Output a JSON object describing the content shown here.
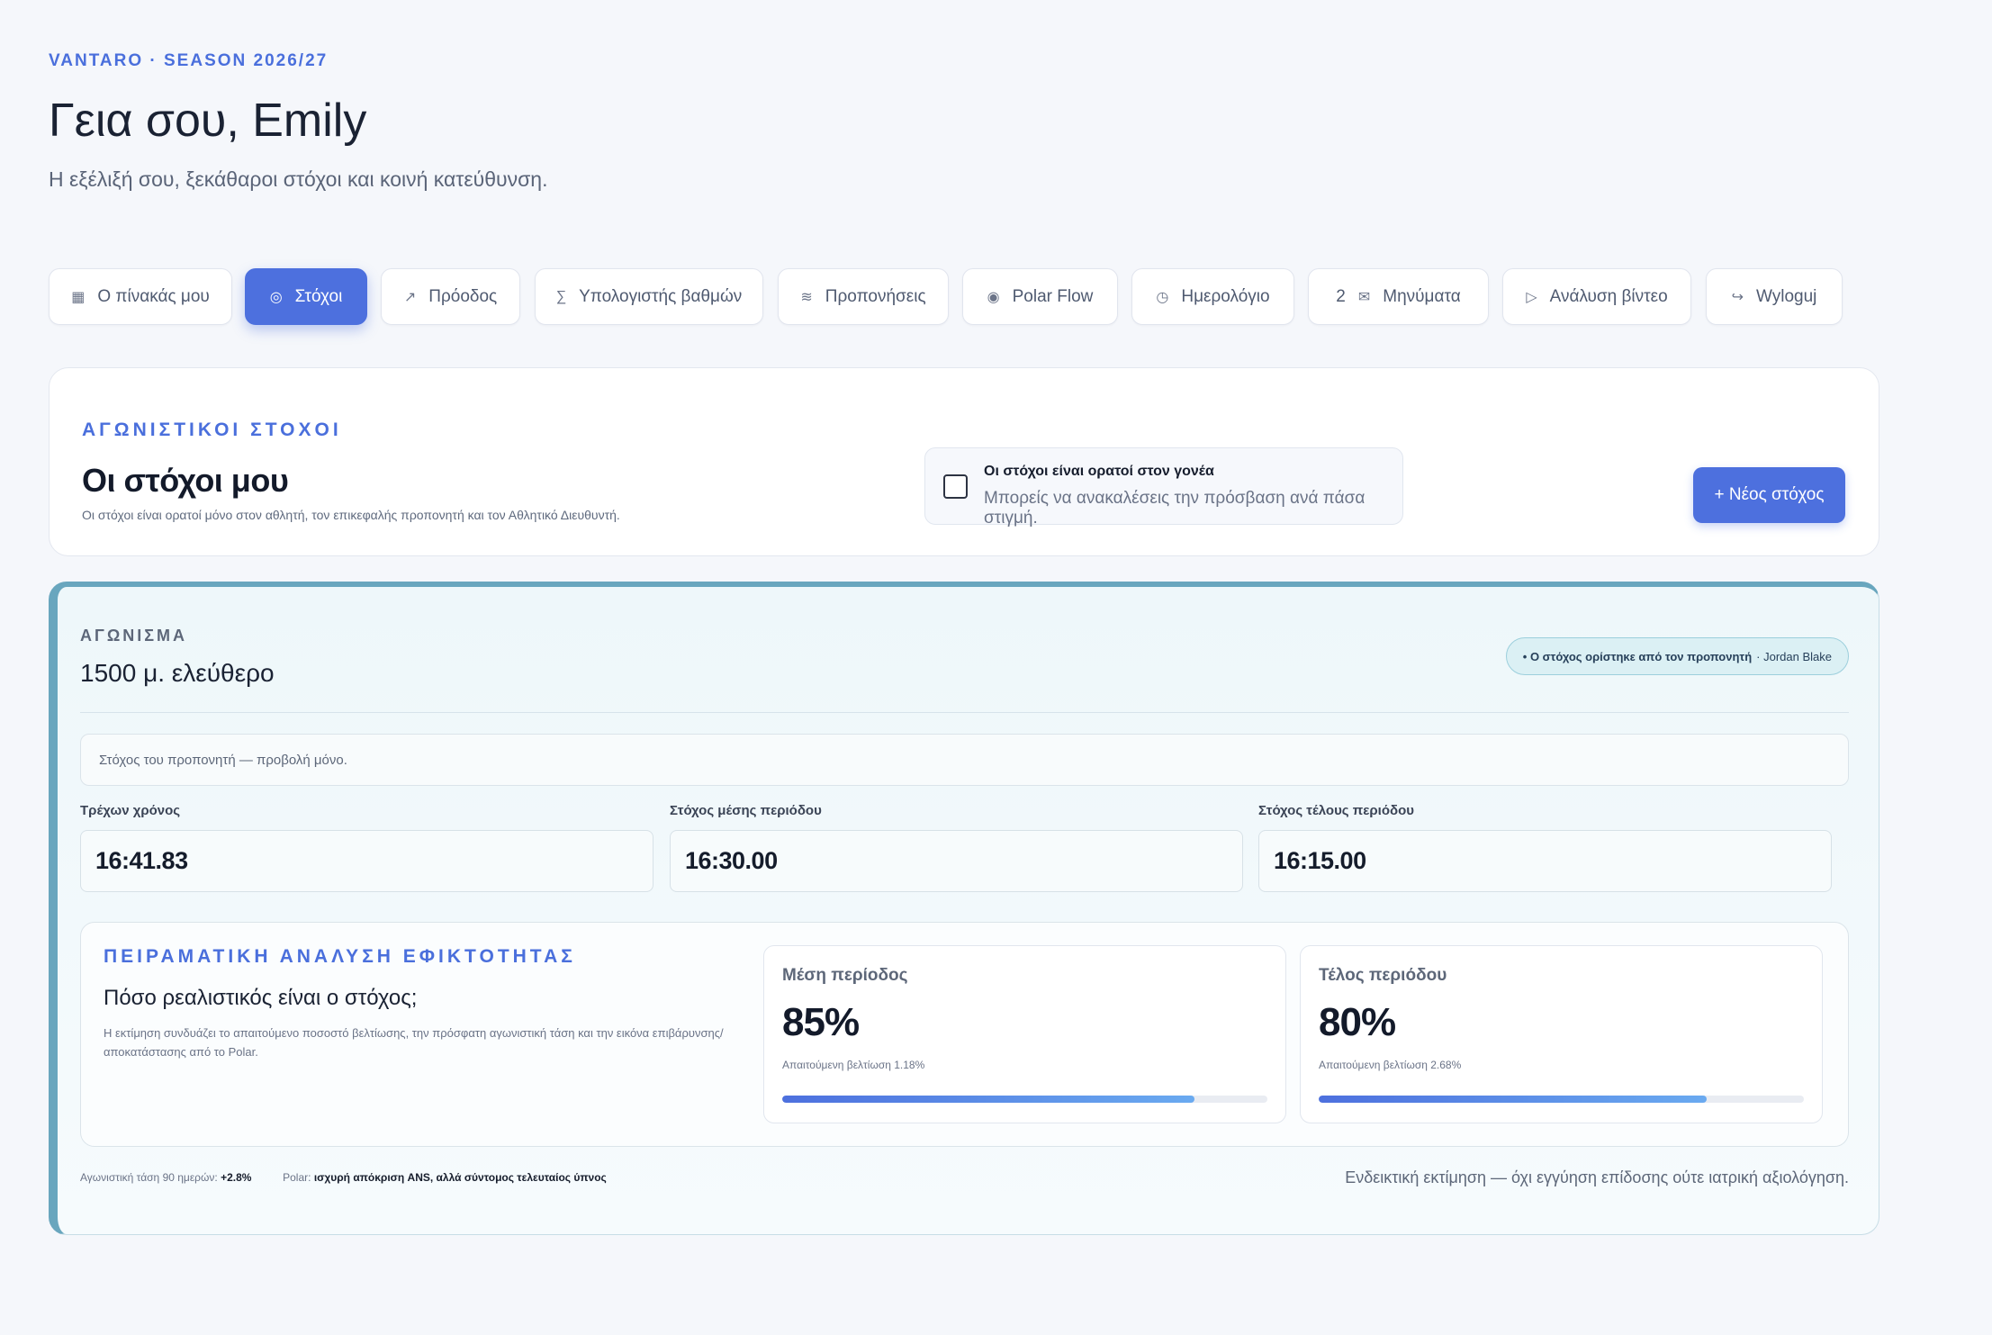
{
  "header": {
    "brand": "VANTARO · SEASON 2026/27",
    "greeting": "Γεια σου, Emily",
    "subtitle": "Η εξέλιξή σου, ξεκάθαροι στόχοι και κοινή κατεύθυνση."
  },
  "nav": [
    {
      "label": "Ο πίνακάς μου",
      "icon": "▦",
      "icon_name": "dashboard-icon",
      "active": false
    },
    {
      "label": "Στόχοι",
      "icon": "◎",
      "icon_name": "target-icon",
      "active": true
    },
    {
      "label": "Πρόοδος",
      "icon": "↗",
      "icon_name": "trend-up-icon",
      "active": false
    },
    {
      "label": "Υπολογιστής βαθμών",
      "icon": "∑",
      "icon_name": "sigma-icon",
      "active": false
    },
    {
      "label": "Προπονήσεις",
      "icon": "≋",
      "icon_name": "waves-icon",
      "active": false
    },
    {
      "label": "Polar Flow",
      "icon": "◉",
      "icon_name": "polar-icon",
      "active": false
    },
    {
      "label": "Ημερολόγιο",
      "icon": "◷",
      "icon_name": "clock-icon",
      "active": false
    },
    {
      "label": "Μηνύματα",
      "icon": "✉",
      "icon_name": "mail-icon",
      "badge": "2",
      "active": false
    },
    {
      "label": "Ανάλυση βίντεο",
      "icon": "▷",
      "icon_name": "play-icon",
      "active": false
    },
    {
      "label": "Wyloguj",
      "icon": "↪",
      "icon_name": "logout-icon",
      "active": false
    }
  ],
  "goals_header": {
    "kicker": "ΑΓΩΝΙΣΤΙΚΟΙ ΣΤΟΧΟΙ",
    "title": "Οι στόχοι μου",
    "description": "Οι στόχοι είναι ορατοί μόνο στον αθλητή, τον επικεφαλής προπονητή και τον Αθλητικό Διευθυντή.",
    "visibility_title": "Οι στόχοι είναι ορατοί στον γονέα",
    "visibility_desc": "Μπορείς να ανακαλέσεις την πρόσβαση ανά πάσα στιγμή.",
    "visibility_checked": false,
    "new_goal_button": "+ Νέος στόχος"
  },
  "goal": {
    "event_kicker": "ΑΓΩΝΙΣΜΑ",
    "event_name": "1500 μ. ελεύθερο",
    "coach_pill_strong": "• Ο στόχος ορίστηκε από τον προπονητή",
    "coach_pill_rest": "· Jordan Blake",
    "readonly_note": "Στόχος του προπονητή — προβολή μόνο.",
    "fields": [
      {
        "label": "Τρέχων χρόνος",
        "value": "16:41.83"
      },
      {
        "label": "Στόχος μέσης περιόδου",
        "value": "16:30.00"
      },
      {
        "label": "Στόχος τέλους περιόδου",
        "value": "16:15.00"
      }
    ],
    "analysis": {
      "kicker": "ΠΕΙΡΑΜΑΤΙΚΗ ΑΝΑΛΥΣΗ ΕΦΙΚΤΟΤΗΤΑΣ",
      "title": "Πόσο ρεαλιστικός είναι ο στόχος;",
      "description": "Η εκτίμηση συνδυάζει το απαιτούμενο ποσοστό βελτίωσης, την πρόσφατη αγωνιστική τάση και την εικόνα επιβάρυνσης/αποκατάστασης από το Polar.",
      "metrics": [
        {
          "label": "Μέση περίοδος",
          "value": "85%",
          "sub": "Απαιτούμενη βελτίωση 1.18%",
          "progress": 0.85
        },
        {
          "label": "Τέλος περιόδου",
          "value": "80%",
          "sub": "Απαιτούμενη βελτίωση 2.68%",
          "progress": 0.8
        }
      ]
    },
    "footer": {
      "trend_label": "Αγωνιστική τάση 90 ημερών:",
      "trend_value": "+2.8%",
      "polar_label": "Polar:",
      "polar_value": "ισχυρή απόκριση ANS, αλλά σύντομος τελευταίος ύπνος",
      "disclaimer": "Ενδεικτική εκτίμηση — όχι εγγύηση επίδοσης ούτε ιατρική αξιολόγηση."
    }
  },
  "colors": {
    "accent": "#4d70de",
    "goal_border": "#69a6be",
    "background": "#f5f7fb"
  }
}
